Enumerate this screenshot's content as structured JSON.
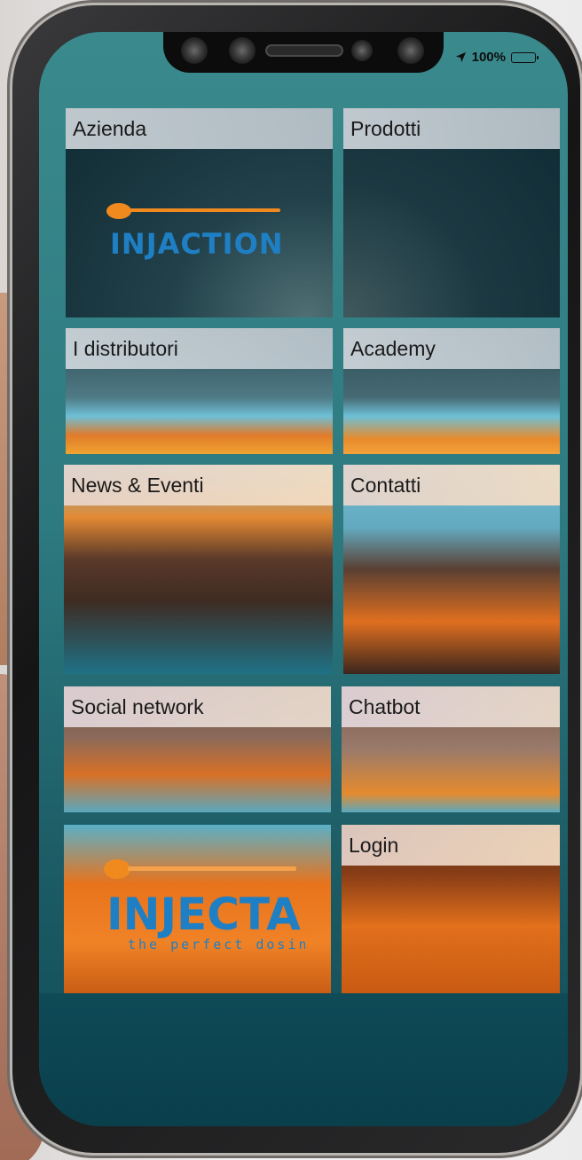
{
  "status_bar": {
    "battery_text": "100%"
  },
  "tiles": [
    {
      "label": "Azienda"
    },
    {
      "label": "Prodotti"
    },
    {
      "label": "I distributori"
    },
    {
      "label": "Academy"
    },
    {
      "label": "News & Eventi"
    },
    {
      "label": "Contatti"
    },
    {
      "label": "Social network"
    },
    {
      "label": "Chatbot"
    },
    {
      "label": "Login"
    }
  ],
  "logos": {
    "injaction": "INJACTION",
    "injecta": "INJECTA",
    "injecta_tagline": "the perfect dosing"
  },
  "colors": {
    "screen_teal": "#2d7a80",
    "logo_orange": "#f08a1e",
    "logo_blue": "#1f7fc4"
  }
}
